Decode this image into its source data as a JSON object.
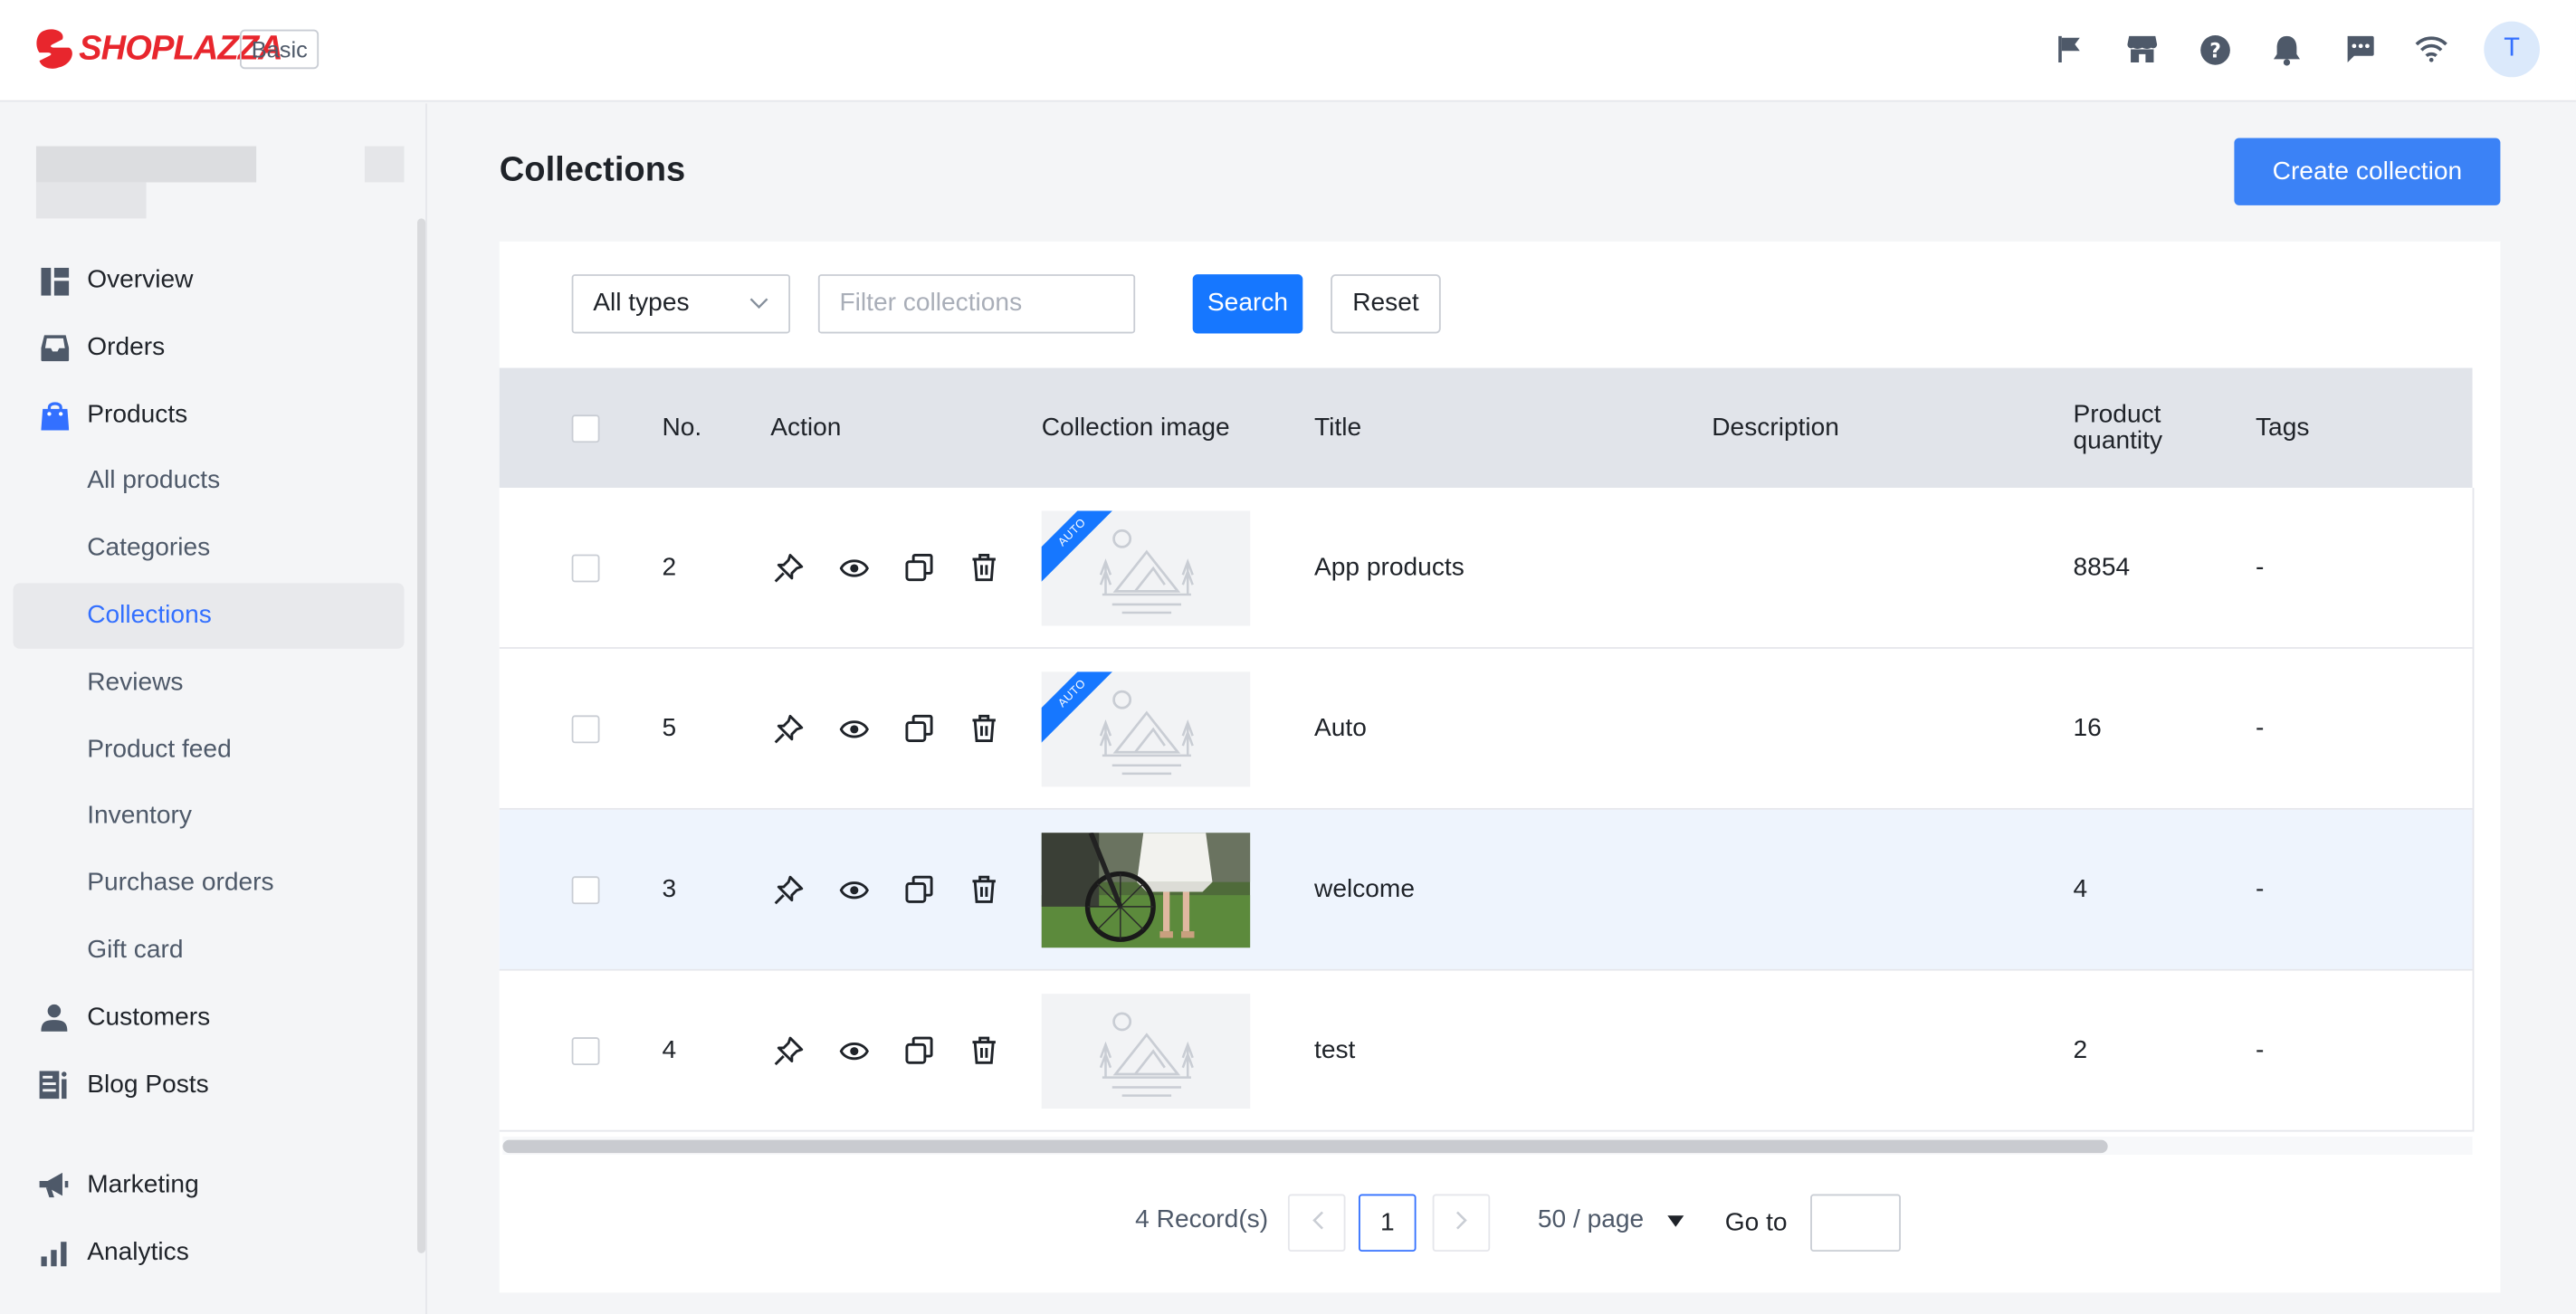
{
  "header": {
    "brand": "SHOPLAZZA",
    "plan": "Basic",
    "avatar_initial": "T",
    "icons": [
      "flag-icon",
      "store-icon",
      "help-icon",
      "bell-icon",
      "chat-icon",
      "wifi-icon"
    ]
  },
  "sidebar": {
    "items": [
      {
        "label": "Overview",
        "icon": "overview-icon"
      },
      {
        "label": "Orders",
        "icon": "inbox-icon"
      },
      {
        "label": "Products",
        "icon": "shopping-bag-icon"
      },
      {
        "label": "All products"
      },
      {
        "label": "Categories"
      },
      {
        "label": "Collections"
      },
      {
        "label": "Reviews"
      },
      {
        "label": "Product feed"
      },
      {
        "label": "Inventory"
      },
      {
        "label": "Purchase orders"
      },
      {
        "label": "Gift card"
      },
      {
        "label": "Customers",
        "icon": "person-icon"
      },
      {
        "label": "Blog Posts",
        "icon": "blog-icon"
      },
      {
        "label": "Marketing",
        "icon": "megaphone-icon"
      },
      {
        "label": "Analytics",
        "icon": "bar-chart-icon"
      }
    ],
    "active": "Collections"
  },
  "main": {
    "title": "Collections",
    "create_label": "Create collection",
    "filters": {
      "type_value": "All types",
      "search_placeholder": "Filter collections",
      "search_label": "Search",
      "reset_label": "Reset"
    },
    "table": {
      "headers": {
        "no": "No.",
        "action": "Action",
        "image": "Collection image",
        "title": "Title",
        "description": "Description",
        "quantity_line1": "Product",
        "quantity_line2": "quantity",
        "tags": "Tags"
      },
      "rows": [
        {
          "no": "2",
          "title": "App products",
          "description": "",
          "quantity": "8854",
          "tags": "-",
          "auto": true,
          "image": "placeholder"
        },
        {
          "no": "5",
          "title": "Auto",
          "description": "",
          "quantity": "16",
          "tags": "-",
          "auto": true,
          "image": "placeholder"
        },
        {
          "no": "3",
          "title": "welcome",
          "description": "",
          "quantity": "4",
          "tags": "-",
          "auto": false,
          "image": "photo"
        },
        {
          "no": "4",
          "title": "test",
          "description": "",
          "quantity": "2",
          "tags": "-",
          "auto": false,
          "image": "placeholder"
        }
      ],
      "auto_tag": "AUTO"
    },
    "pagination": {
      "records": "4 Record(s)",
      "current_page": "1",
      "page_size": "50 / page",
      "goto_label": "Go to"
    }
  }
}
